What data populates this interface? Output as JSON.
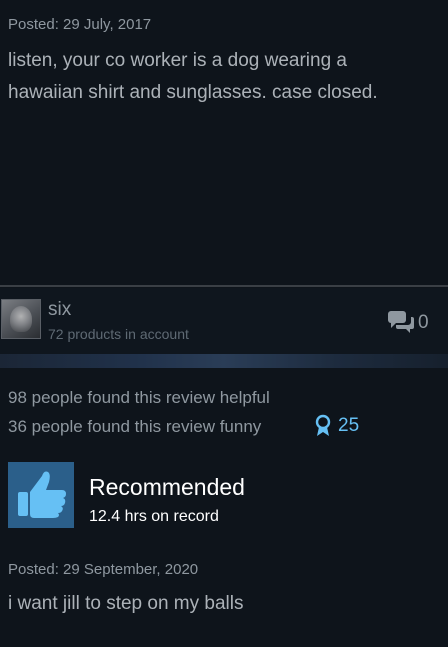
{
  "review_previous": {
    "posted": "Posted: 29 July, 2017",
    "text_line1": "listen, your co worker is a dog wearing a",
    "text_line2": "hawaiian shirt and sunglasses. case closed."
  },
  "author": {
    "name": "six",
    "products": "72 products in account",
    "comment_count": "0"
  },
  "review_stats": {
    "helpful": "98 people found this review helpful",
    "funny": "36 people found this review funny",
    "award_count": "25"
  },
  "recommendation": {
    "label": "Recommended",
    "hours": "12.4 hrs on record"
  },
  "review_current": {
    "posted": "Posted: 29 September, 2020",
    "text": "i want jill to step on my balls"
  },
  "colors": {
    "background": "#0e141b",
    "accent": "#66c0f4",
    "thumb_box": "#2b5f8a"
  },
  "icons": [
    "comment-icon",
    "award-ribbon-icon",
    "thumbs-up-icon"
  ]
}
